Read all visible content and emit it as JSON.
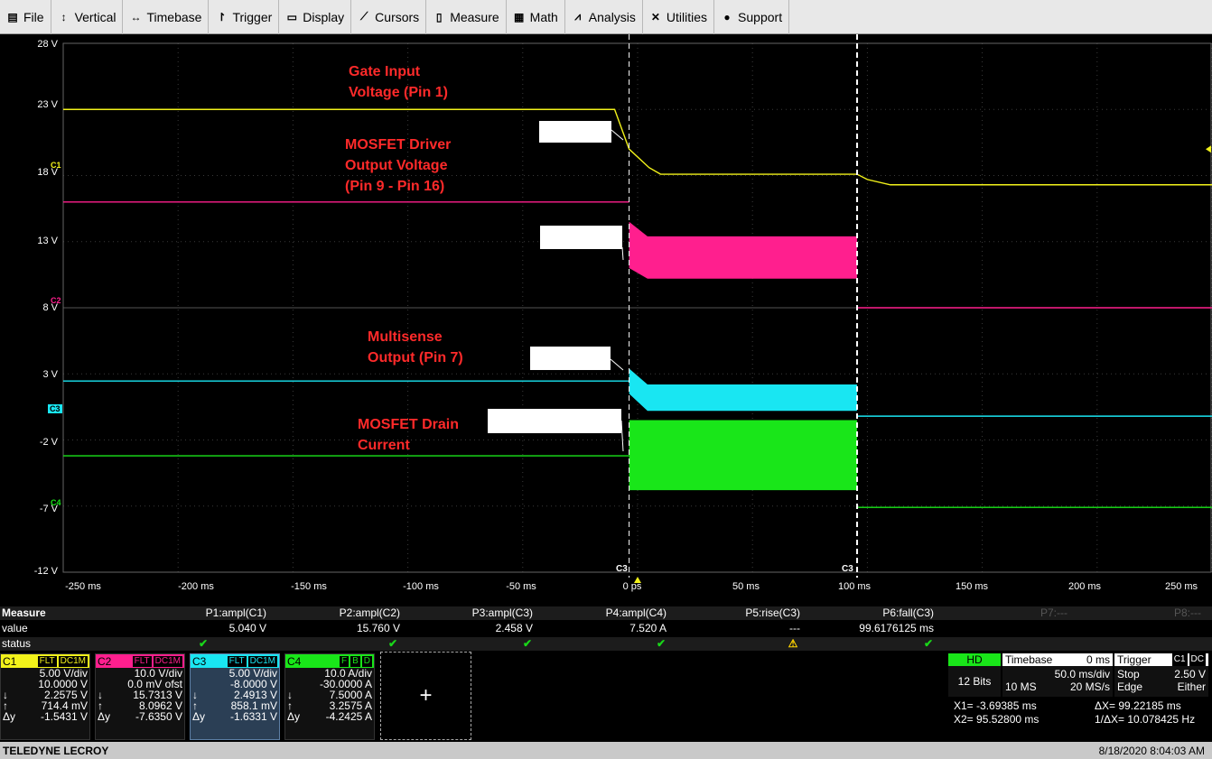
{
  "menu": [
    {
      "icon": "file-icon",
      "label": "File"
    },
    {
      "icon": "vertical-icon",
      "label": "Vertical"
    },
    {
      "icon": "timebase-icon",
      "label": "Timebase"
    },
    {
      "icon": "trigger-icon",
      "label": "Trigger"
    },
    {
      "icon": "display-icon",
      "label": "Display"
    },
    {
      "icon": "cursors-icon",
      "label": "Cursors"
    },
    {
      "icon": "measure-icon",
      "label": "Measure"
    },
    {
      "icon": "math-icon",
      "label": "Math"
    },
    {
      "icon": "analysis-icon",
      "label": "Analysis"
    },
    {
      "icon": "utilities-icon",
      "label": "Utilities"
    },
    {
      "icon": "support-icon",
      "label": "Support"
    }
  ],
  "chart_data": {
    "type": "line",
    "x_ticks": [
      "-250 ms",
      "-200 ms",
      "-150 ms",
      "-100 ms",
      "-50 ms",
      "0 ps",
      "50 ms",
      "100 ms",
      "150 ms",
      "200 ms",
      "250 ms"
    ],
    "y_ticks": [
      "28 V",
      "23 V",
      "18 V",
      "13 V",
      "8 V",
      "3 V",
      "-2 V",
      "-7 V",
      "-12 V"
    ],
    "xlim_ms": [
      -250,
      250
    ],
    "ylim_V": [
      -12,
      28
    ],
    "grid": true,
    "cursors_ms": [
      -3.69385,
      95.528
    ],
    "cursor_label": "C3",
    "series": [
      {
        "name": "C1",
        "color": "#f2f21a",
        "x": [
          -250,
          -10,
          -3.7,
          5,
          10,
          95.5,
          100,
          110,
          250
        ],
        "y": [
          23,
          23,
          20,
          18.6,
          18.1,
          18.1,
          17.7,
          17.3,
          17.3
        ]
      },
      {
        "name": "C2",
        "color": "#ff1f8e",
        "x": [
          -250,
          -3.7
        ],
        "y": [
          16,
          16
        ],
        "band_x": [
          -3.7,
          95.5
        ],
        "band_top": [
          14.5,
          13.4
        ],
        "band_bottom": [
          11,
          10.2
        ],
        "after_x": [
          95.5,
          250
        ],
        "after_y": [
          8,
          8
        ]
      },
      {
        "name": "C3",
        "color": "#19e6f2",
        "x": [
          -250,
          -3.7
        ],
        "y": [
          2.46,
          2.46
        ],
        "band_x": [
          -3.7,
          95.5
        ],
        "band_top": [
          3.4,
          2.2
        ],
        "band_bottom": [
          1.5,
          0.2
        ],
        "after_x": [
          95.5,
          250
        ],
        "after_y": [
          -0.2,
          -0.2
        ]
      },
      {
        "name": "C4",
        "color": "#19e619",
        "x": [
          -250,
          -3.7
        ],
        "y": [
          -3.2,
          -3.2
        ],
        "band_x": [
          -3.7,
          95.5
        ],
        "band_top": [
          -0.5,
          -0.5
        ],
        "band_bottom": [
          -5.8,
          -5.8
        ],
        "after_x": [
          95.5,
          250
        ],
        "after_y": [
          -7.1,
          -7.1
        ]
      }
    ]
  },
  "channel_markers": [
    "C1",
    "C2",
    "C3",
    "C4"
  ],
  "annotations": [
    {
      "text": "Gate Input\nVoltage (Pin 1)"
    },
    {
      "text": "MOSFET Driver\nOutput Voltage\n(Pin 9 - Pin  16)"
    },
    {
      "text": "Multisense\nOutput (Pin 7)"
    },
    {
      "text": "MOSFET Drain\nCurrent"
    }
  ],
  "measure": {
    "title": "Measure",
    "row_value": "value",
    "row_status": "status",
    "params": [
      {
        "name": "P1:ampl(C1)",
        "value": "5.040 V",
        "status": "✔"
      },
      {
        "name": "P2:ampl(C2)",
        "value": "15.760 V",
        "status": "✔"
      },
      {
        "name": "P3:ampl(C3)",
        "value": "2.458 V",
        "status": "✔"
      },
      {
        "name": "P4:ampl(C4)",
        "value": "7.520 A",
        "status": "✔"
      },
      {
        "name": "P5:rise(C3)",
        "value": "---",
        "status": "⚠"
      },
      {
        "name": "P6:fall(C3)",
        "value": "99.6176125 ms",
        "status": "✔"
      },
      {
        "name": "P7:---",
        "value": "",
        "status": ""
      },
      {
        "name": "P8:---",
        "value": "",
        "status": ""
      }
    ]
  },
  "channels": [
    {
      "name": "C1",
      "color": "#f2f21a",
      "tags": [
        "FLT",
        "DC1M"
      ],
      "lines": [
        [
          "",
          "5.00 V/div"
        ],
        [
          "",
          "10.0000 V"
        ],
        [
          "↓",
          "2.2575 V"
        ],
        [
          "↑",
          "714.4 mV"
        ],
        [
          "Δy",
          "-1.5431 V"
        ]
      ]
    },
    {
      "name": "C2",
      "color": "#ff1f8e",
      "tags": [
        "FLT",
        "DC1M"
      ],
      "lines": [
        [
          "",
          "10.0 V/div"
        ],
        [
          "",
          "0.0 mV ofst"
        ],
        [
          "↓",
          "15.7313 V"
        ],
        [
          "↑",
          "8.0962 V"
        ],
        [
          "Δy",
          "-7.6350 V"
        ]
      ]
    },
    {
      "name": "C3",
      "color": "#19e6f2",
      "tags": [
        "FLT",
        "DC1M"
      ],
      "lines": [
        [
          "",
          "5.00 V/div"
        ],
        [
          "",
          "-8.0000 V"
        ],
        [
          "↓",
          "2.4913 V"
        ],
        [
          "↑",
          "858.1 mV"
        ],
        [
          "Δy",
          "-1.6331 V"
        ]
      ]
    },
    {
      "name": "C4",
      "color": "#19e619",
      "tags": [
        "F",
        "B",
        "D"
      ],
      "lines": [
        [
          "",
          "10.0 A/div"
        ],
        [
          "",
          "-30.0000 A"
        ],
        [
          "↓",
          "7.5000 A"
        ],
        [
          "↑",
          "3.2575 A"
        ],
        [
          "Δy",
          "-4.2425 A"
        ]
      ]
    }
  ],
  "add_label": "+",
  "hd": {
    "label": "HD",
    "bits": "12 Bits"
  },
  "timebase": {
    "title": "Timebase",
    "offset": "0 ms",
    "div": "50.0 ms/div",
    "samples": "10 MS",
    "rate": "20 MS/s"
  },
  "trigger": {
    "title": "Trigger",
    "tags": [
      "C1",
      "DC"
    ],
    "mode": "Stop",
    "level": "2.50 V",
    "type": "Edge",
    "slope": "Either"
  },
  "cursor_readout": {
    "x1": "X1= -3.69385 ms",
    "dx": "ΔX= 99.22185 ms",
    "x2": "X2= 95.52800 ms",
    "inv": "1/ΔX= 10.078425 Hz"
  },
  "brand": "TELEDYNE LECROY",
  "datetime": "8/18/2020 8:04:03 AM"
}
